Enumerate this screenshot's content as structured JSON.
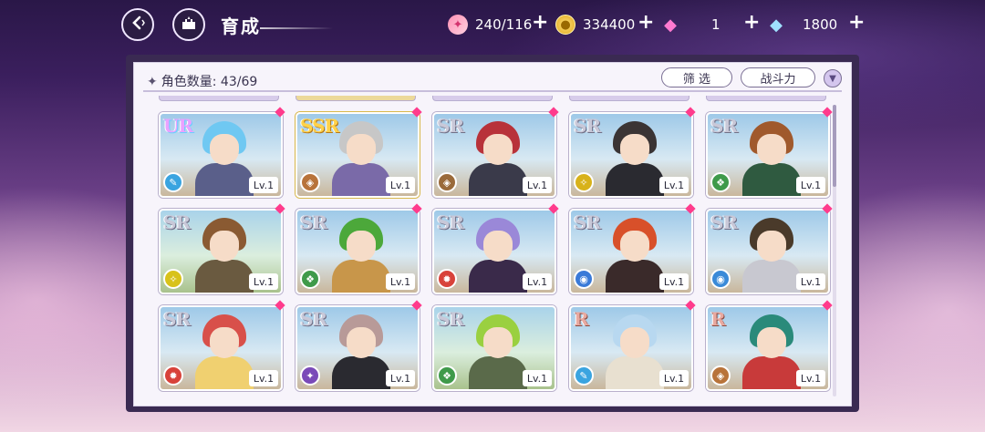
{
  "header": {
    "title": "育成",
    "back_icon": "back-arrow-icon",
    "home_icon": "castle-icon",
    "resources": [
      {
        "name": "stamina",
        "icon": "candy-icon",
        "value": "240/116"
      },
      {
        "name": "gold",
        "icon": "coin-icon",
        "value": "334400"
      },
      {
        "name": "pink-gem",
        "icon": "pink-diamond-icon",
        "value": "1"
      },
      {
        "name": "blue-gem",
        "icon": "blue-diamond-icon",
        "value": "1800"
      }
    ],
    "plus_label": "+"
  },
  "panel": {
    "count_label": "角色数量",
    "count_value": "43/69",
    "filter_label": "筛 选",
    "sort_label": "战斗力",
    "sort_icon": "chevron-down-icon"
  },
  "cards": [
    {
      "rarity": "UR",
      "element": "wind",
      "element_color": "#3aa4e0",
      "level": "Lv.1",
      "hair": "#6fc8f2",
      "outfit": "#5a5f8a",
      "bg": "sky",
      "new": true
    },
    {
      "rarity": "SSR",
      "element": "earth",
      "element_color": "#b8733a",
      "level": "Lv.1",
      "hair": "#c7c7c7",
      "outfit": "#7a6aa8",
      "bg": "sky",
      "new": true
    },
    {
      "rarity": "SR",
      "element": "earth",
      "element_color": "#9a6a3a",
      "level": "Lv.1",
      "hair": "#b8323a",
      "outfit": "#3a3a4a",
      "bg": "sky",
      "new": true
    },
    {
      "rarity": "SR",
      "element": "light",
      "element_color": "#d8b21a",
      "level": "Lv.1",
      "hair": "#3a3434",
      "outfit": "#2a2a30",
      "bg": "sky",
      "new": true
    },
    {
      "rarity": "SR",
      "element": "nature",
      "element_color": "#3f9a4a",
      "level": "Lv.1",
      "hair": "#a0592c",
      "outfit": "#2f5a40",
      "bg": "sky",
      "new": true
    },
    {
      "rarity": "SR",
      "element": "light",
      "element_color": "#d8c21a",
      "level": "Lv.1",
      "hair": "#8a5a32",
      "outfit": "#6a5a40",
      "bg": "sky-green",
      "new": true
    },
    {
      "rarity": "SR",
      "element": "nature",
      "element_color": "#3f9a4a",
      "level": "Lv.1",
      "hair": "#4ca83a",
      "outfit": "#c8964a",
      "bg": "sky",
      "new": true
    },
    {
      "rarity": "SR",
      "element": "fire",
      "element_color": "#d8423a",
      "level": "Lv.1",
      "hair": "#9a88d8",
      "outfit": "#3a2a4a",
      "bg": "sky",
      "new": true
    },
    {
      "rarity": "SR",
      "element": "water",
      "element_color": "#3a7ad8",
      "level": "Lv.1",
      "hair": "#d8502a",
      "outfit": "#3a2a2a",
      "bg": "sky",
      "new": true
    },
    {
      "rarity": "SR",
      "element": "water",
      "element_color": "#3a8ad8",
      "level": "Lv.1",
      "hair": "#4a3a2a",
      "outfit": "#c8c8d0",
      "bg": "sky",
      "new": true
    },
    {
      "rarity": "SR",
      "element": "fire",
      "element_color": "#d8423a",
      "level": "Lv.1",
      "hair": "#d8504a",
      "outfit": "#f0d070",
      "bg": "sky",
      "new": true
    },
    {
      "rarity": "SR",
      "element": "dark",
      "element_color": "#7a4ab8",
      "level": "Lv.1",
      "hair": "#b89a98",
      "outfit": "#2a2a30",
      "bg": "sky",
      "new": true
    },
    {
      "rarity": "SR",
      "element": "nature",
      "element_color": "#3f9a4a",
      "level": "Lv.1",
      "hair": "#9ad040",
      "outfit": "#5a6a4a",
      "bg": "sky-green",
      "new": false
    },
    {
      "rarity": "R",
      "element": "wind",
      "element_color": "#3aa4e0",
      "level": "Lv.1",
      "hair": "#b8d8f0",
      "outfit": "#e8e0d0",
      "bg": "sky",
      "new": true
    },
    {
      "rarity": "R",
      "element": "earth",
      "element_color": "#b8733a",
      "level": "Lv.1",
      "hair": "#2a8a7a",
      "outfit": "#c83a3a",
      "bg": "sky",
      "new": true
    }
  ]
}
